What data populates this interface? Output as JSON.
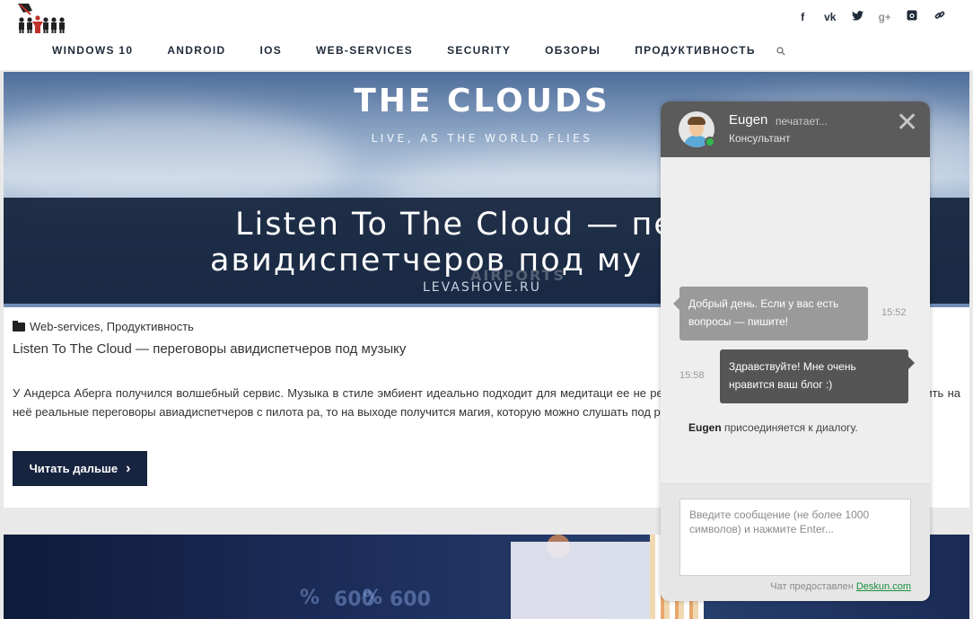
{
  "header": {
    "social_icons": [
      "facebook-icon",
      "vk-icon",
      "twitter-icon",
      "google-plus-icon",
      "instagram-icon",
      "link-icon"
    ],
    "social_glyphs": [
      "f",
      "vk",
      "t",
      "g+",
      "◘",
      "⚭"
    ],
    "nav": [
      "WINDOWS 10",
      "ANDROID",
      "IOS",
      "WEB-SERVICES",
      "SECURITY",
      "ОБЗОРЫ",
      "ПРОДУКТИВНОСТЬ"
    ]
  },
  "article": {
    "hero_title": "THE CLOUDS",
    "hero_subtitle": "LIVE, AS THE WORLD FLIES",
    "hero_head_line1": "Listen To The Cloud — пер",
    "hero_head_line2": "авидиспетчеров под му",
    "hero_watermark": "AIRPORTS",
    "hero_site": "LEVASHOVE.RU",
    "categories": [
      "Web-services",
      "Продуктивность"
    ],
    "title": "Listen To The Cloud — переговоры авидиспетчеров под музыку",
    "excerpt": "У Андерса Аберга получился волшебный сервис. Музыка в стиле эмбиент идеально подходит для медитаци                                                                        ее не рекомендовал. Можно и уснуть. А вот если наложить на неё реальные переговоры авиадиспетчеров с пилота                                                                      ра, то на выходе получится магия, которую можно слушать под работу весь день.",
    "read_more": "Читать дальше",
    "read_more_arrow": "›"
  },
  "card2": {
    "numbers": [
      "%",
      "600",
      "%",
      "600"
    ]
  },
  "chat": {
    "agent_name": "Eugen",
    "status": "печатает...",
    "role": "Консультант",
    "close": "✕",
    "messages": [
      {
        "from": "agent",
        "text": "Добрый день. Если у вас есть вопросы — пишите!",
        "time": "15:52"
      },
      {
        "from": "user",
        "text": "Здравствуйте! Мне очень нравится ваш блог :)",
        "time": "15:58"
      }
    ],
    "system_name": "Eugen",
    "system_text": " присоединяется к диалогу.",
    "input_placeholder": "Введите сообщение (не более 1000 символов) и нажмите Enter...",
    "powered_prefix": "Чат предоставлен ",
    "powered_link": "Deskun.com"
  },
  "colors": {
    "nav_text": "#1f2b3a",
    "button_bg": "#172440",
    "chat_header": "#5b5b5b",
    "agent_bubble": "#9a9a9a",
    "user_bubble": "#555555",
    "online": "#2fb84a",
    "link_green": "#1a8f3c"
  }
}
